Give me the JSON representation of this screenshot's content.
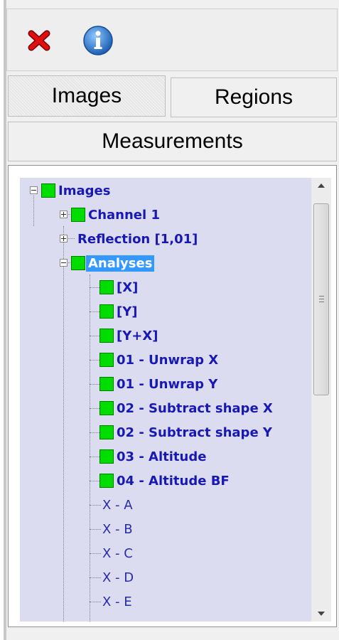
{
  "toolbar": {
    "delete_icon": "red-x-icon",
    "info_icon": "info-icon"
  },
  "tabs": {
    "images": "Images",
    "regions": "Regions",
    "measurements": "Measurements"
  },
  "tree": {
    "root": "Images",
    "channel": "Channel 1",
    "reflection": "Reflection [1,01]",
    "analyses": "Analyses",
    "analysis_items": [
      "[X]",
      "[Y]",
      "[Y+X]",
      "01 - Unwrap X",
      "01 - Unwrap Y",
      "02 - Subtract shape X",
      "02 - Subtract shape Y",
      "03 - Altitude",
      "04 - Altitude BF"
    ],
    "plain_items": [
      "X - A",
      "X - B",
      "X - C",
      "X - D",
      "X - E"
    ]
  },
  "colors": {
    "selected": "#3399ff",
    "node_text": "#1818b4",
    "indicator": "#00dd00"
  }
}
